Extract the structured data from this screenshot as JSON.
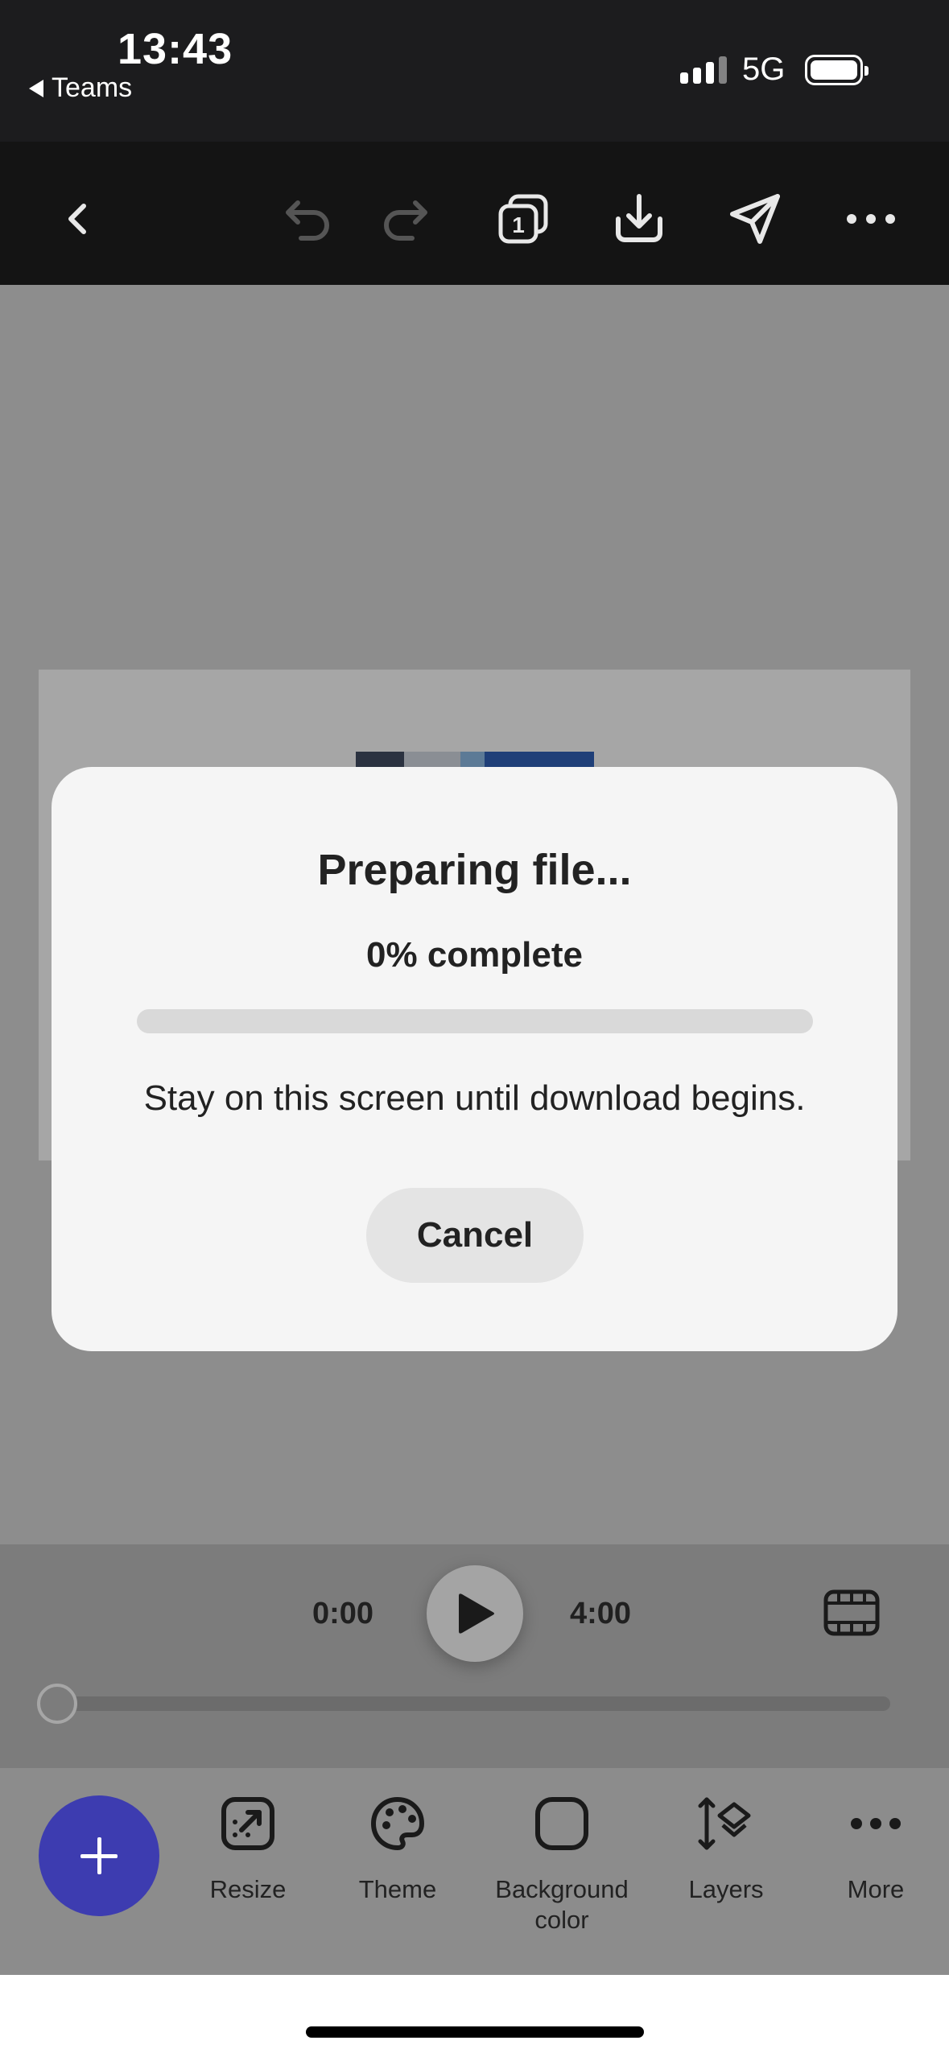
{
  "status_bar": {
    "time": "13:43",
    "back_app": "Teams",
    "network": "5G"
  },
  "toolbar": {
    "icons": [
      "back-icon",
      "undo-icon",
      "redo-icon",
      "pages-icon",
      "download-icon",
      "share-icon",
      "more-icon"
    ],
    "pages_count": "1"
  },
  "playback": {
    "start_time": "0:00",
    "end_time": "4:00"
  },
  "tools": [
    {
      "label": "Resize",
      "icon": "resize-icon"
    },
    {
      "label": "Theme",
      "icon": "palette-icon"
    },
    {
      "label": "Background color",
      "icon": "background-color-icon"
    },
    {
      "label": "Layers",
      "icon": "layers-icon"
    },
    {
      "label": "More",
      "icon": "more-icon"
    }
  ],
  "modal": {
    "title": "Preparing file...",
    "progress_text": "0% complete",
    "progress_fraction": 0,
    "message": "Stay on this screen until download begins.",
    "cancel_label": "Cancel"
  },
  "colors": {
    "accent": "#3d3cb0",
    "toolbar_bg": "#141414",
    "modal_bg": "#f5f5f5"
  }
}
